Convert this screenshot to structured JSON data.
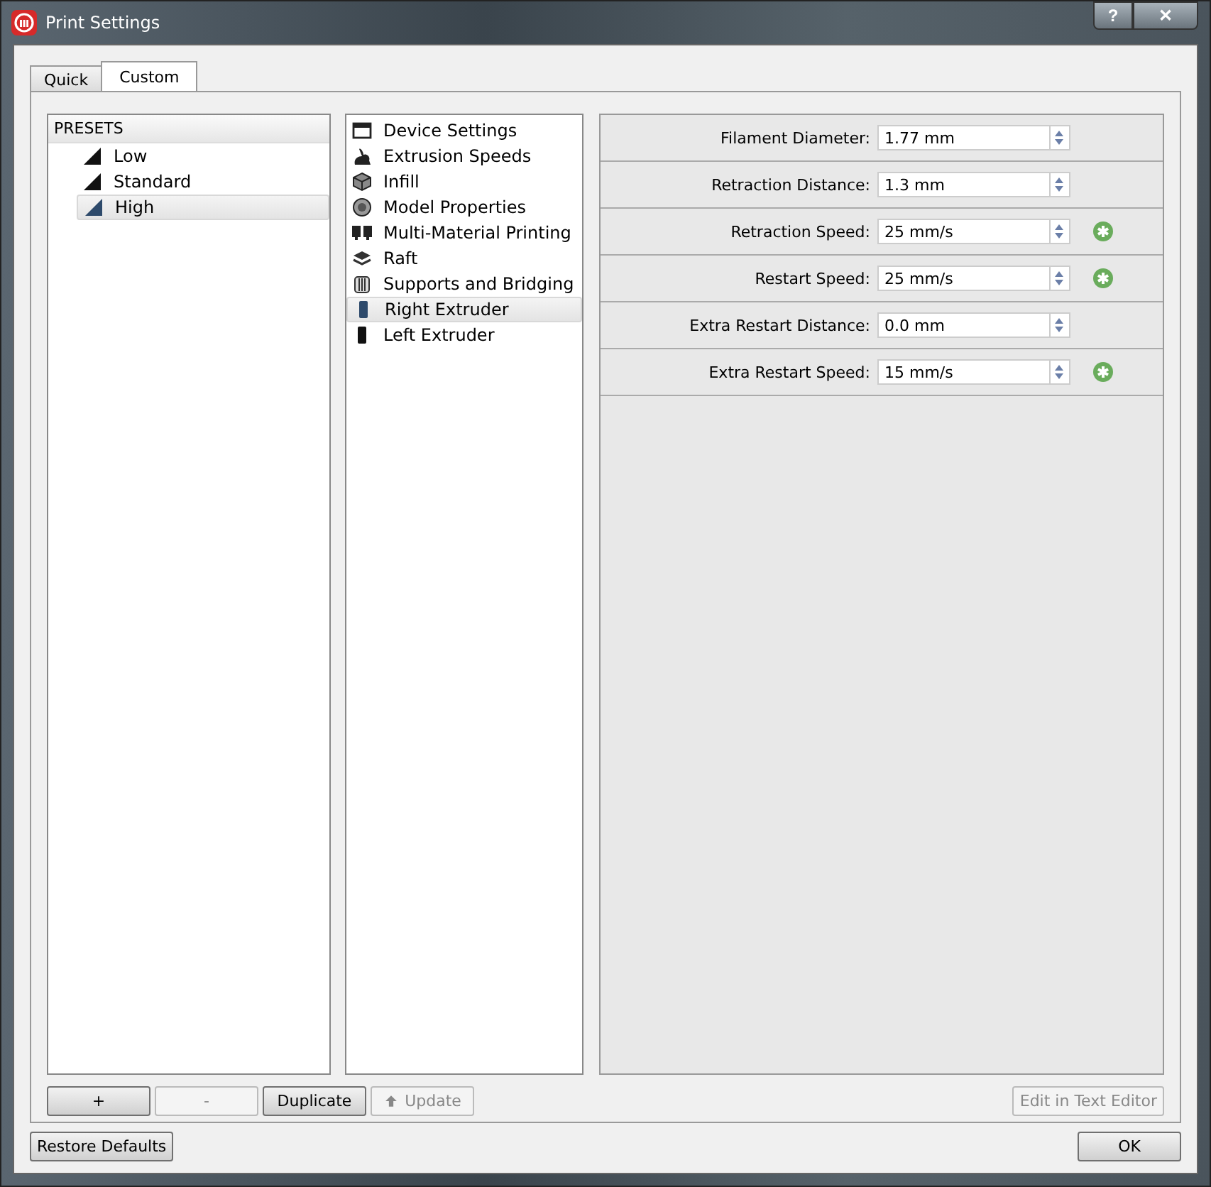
{
  "window": {
    "title": "Print Settings",
    "help": "?",
    "close": "✕"
  },
  "tabs": [
    {
      "label": "Quick",
      "selected": false
    },
    {
      "label": "Custom",
      "selected": true
    }
  ],
  "presets": {
    "header": "PRESETS",
    "items": [
      {
        "label": "Low",
        "selected": false
      },
      {
        "label": "Standard",
        "selected": false
      },
      {
        "label": "High",
        "selected": true
      }
    ]
  },
  "categories": [
    {
      "label": "Device Settings",
      "selected": false
    },
    {
      "label": "Extrusion Speeds",
      "selected": false
    },
    {
      "label": "Infill",
      "selected": false
    },
    {
      "label": "Model Properties",
      "selected": false
    },
    {
      "label": "Multi-Material Printing",
      "selected": false
    },
    {
      "label": "Raft",
      "selected": false
    },
    {
      "label": "Supports and Bridging",
      "selected": false
    },
    {
      "label": "Right Extruder",
      "selected": true
    },
    {
      "label": "Left Extruder",
      "selected": false
    }
  ],
  "settings": [
    {
      "label": "Filament Diameter:",
      "value": "1.77 mm",
      "modified": false
    },
    {
      "label": "Retraction Distance:",
      "value": "1.3 mm",
      "modified": false
    },
    {
      "label": "Retraction Speed:",
      "value": "25 mm/s",
      "modified": true
    },
    {
      "label": "Restart Speed:",
      "value": "25 mm/s",
      "modified": true
    },
    {
      "label": "Extra Restart Distance:",
      "value": "0.0 mm",
      "modified": false
    },
    {
      "label": "Extra Restart Speed:",
      "value": "15 mm/s",
      "modified": true
    }
  ],
  "preset_buttons": [
    {
      "label": "+",
      "disabled": false
    },
    {
      "label": "-",
      "disabled": true
    },
    {
      "label": "Duplicate",
      "disabled": false
    },
    {
      "label": "Update",
      "disabled": true
    }
  ],
  "editor_button": {
    "label": "Edit in Text Editor",
    "disabled": true
  },
  "footer": {
    "restore": "Restore Defaults",
    "ok": "OK"
  }
}
